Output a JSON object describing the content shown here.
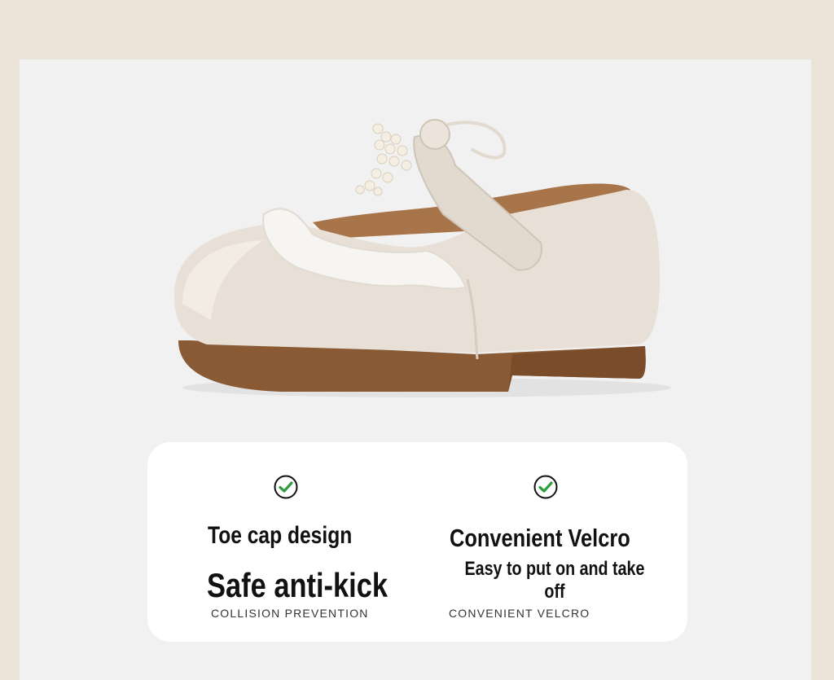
{
  "colors": {
    "page_background": "#ebe3d8",
    "photo_background": "#f1f1f1",
    "card_background": "#ffffff",
    "check_color": "#2f9e3e",
    "shoe_leather": "#e8e0d6",
    "sole": "#8a5a34"
  },
  "product_photo": {
    "subject": "beige children's Mary Jane shoe with lace trim, pearl bow strap and brown sole"
  },
  "features": [
    {
      "icon": "check-circle-icon",
      "title": "Toe cap design",
      "heading": "Safe anti-kick",
      "caption": "COLLISION PREVENTION"
    },
    {
      "icon": "check-circle-icon",
      "title": "Convenient Velcro",
      "subtitle": "Easy to put on and take off",
      "caption": "CONVENIENT VELCRO"
    }
  ]
}
